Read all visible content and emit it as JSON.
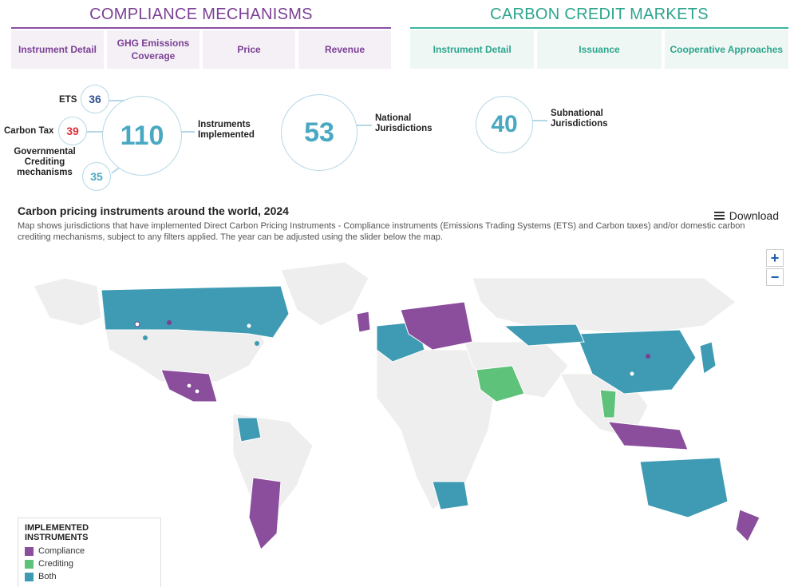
{
  "colors": {
    "compliance": "#8a4e9c",
    "crediting": "#5ec27a",
    "both": "#3e9bb3",
    "land": "#eeeeee",
    "accent_purple": "#7b3f94",
    "accent_teal": "#2ca58d"
  },
  "header_left": {
    "title": "COMPLIANCE MECHANISMS",
    "tabs": [
      "Instrument Detail",
      "GHG Emissions Coverage",
      "Price",
      "Revenue"
    ]
  },
  "header_right": {
    "title": "CARBON CREDIT MARKETS",
    "tabs": [
      "Instrument Detail",
      "Issuance",
      "Cooperative Approaches"
    ]
  },
  "stats": {
    "ets": {
      "label": "ETS",
      "value": "36"
    },
    "carbon_tax": {
      "label": "Carbon Tax",
      "value": "39"
    },
    "crediting": {
      "label": "Governmental Crediting mechanisms",
      "value": "35"
    },
    "instruments": {
      "label": "Instruments Implemented",
      "value": "110"
    },
    "national": {
      "label": "National Jurisdictions",
      "value": "53"
    },
    "subnational": {
      "label": "Subnational Jurisdictions",
      "value": "40"
    }
  },
  "map": {
    "title": "Carbon pricing instruments around the world, 2024",
    "description": "Map shows jurisdictions that have implemented Direct Carbon Pricing Instruments - Compliance instruments (Emissions Trading Systems (ETS) and Carbon taxes) and/or domestic carbon crediting mechanisms, subject to any filters applied. The year can be adjusted using the slider below the map.",
    "download_label": "Download",
    "zoom_in": "+",
    "zoom_out": "−",
    "legend": {
      "title": "IMPLEMENTED INSTRUMENTS",
      "items": [
        {
          "label": "Compliance",
          "category": "compliance"
        },
        {
          "label": "Crediting",
          "category": "crediting"
        },
        {
          "label": "Both",
          "category": "both"
        }
      ]
    }
  }
}
